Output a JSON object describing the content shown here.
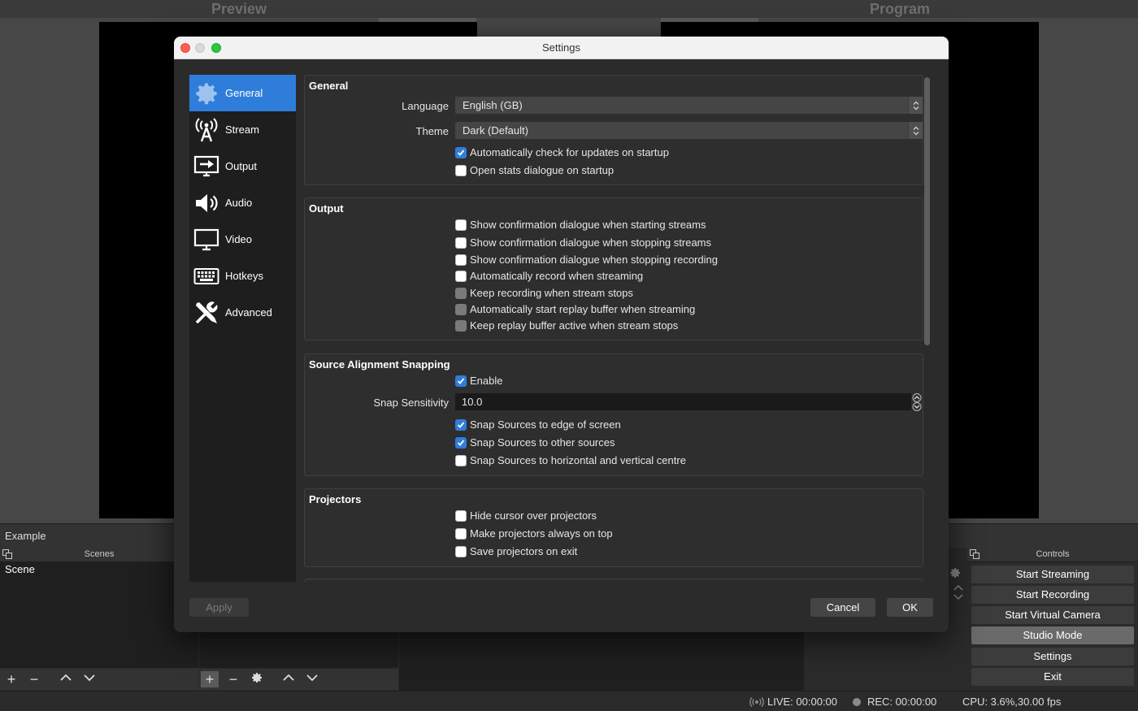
{
  "background": {
    "preview_label": "Preview",
    "program_label": "Program",
    "scene_collection": "Example",
    "scenes_dock_title": "Scenes",
    "scene_items": [
      "Scene"
    ],
    "controls_dock_title": "Controls",
    "controls": [
      "Start Streaming",
      "Start Recording",
      "Start Virtual Camera",
      "Studio Mode",
      "Settings",
      "Exit"
    ],
    "status": {
      "live": "LIVE: 00:00:00",
      "rec": "REC: 00:00:00",
      "cpu": "CPU: 3.6%,30.00 fps"
    }
  },
  "dialog": {
    "title": "Settings",
    "sidebar": [
      {
        "label": "General",
        "icon": "gear-icon",
        "selected": true
      },
      {
        "label": "Stream",
        "icon": "antenna-icon"
      },
      {
        "label": "Output",
        "icon": "output-icon"
      },
      {
        "label": "Audio",
        "icon": "speaker-icon"
      },
      {
        "label": "Video",
        "icon": "monitor-icon"
      },
      {
        "label": "Hotkeys",
        "icon": "keyboard-icon"
      },
      {
        "label": "Advanced",
        "icon": "tools-icon"
      }
    ],
    "general": {
      "title": "General",
      "language_label": "Language",
      "language_value": "English (GB)",
      "theme_label": "Theme",
      "theme_value": "Dark (Default)",
      "checkboxes": [
        {
          "label": "Automatically check for updates on startup",
          "checked": true
        },
        {
          "label": "Open stats dialogue on startup",
          "checked": false
        }
      ]
    },
    "output": {
      "title": "Output",
      "checkboxes": [
        {
          "label": "Show confirmation dialogue when starting streams",
          "checked": false
        },
        {
          "label": "Show confirmation dialogue when stopping streams",
          "checked": false
        },
        {
          "label": "Show confirmation dialogue when stopping recording",
          "checked": false
        },
        {
          "label": "Automatically record when streaming",
          "checked": false
        },
        {
          "label": "Keep recording when stream stops",
          "checked": false,
          "disabled": true
        },
        {
          "label": "Automatically start replay buffer when streaming",
          "checked": false,
          "disabled": true
        },
        {
          "label": "Keep replay buffer active when stream stops",
          "checked": false,
          "disabled": true
        }
      ]
    },
    "snapping": {
      "title": "Source Alignment Snapping",
      "enable_label": "Enable",
      "enable_checked": true,
      "sensitivity_label": "Snap Sensitivity",
      "sensitivity_value": "10.0",
      "checkboxes": [
        {
          "label": "Snap Sources to edge of screen",
          "checked": true
        },
        {
          "label": "Snap Sources to other sources",
          "checked": true
        },
        {
          "label": "Snap Sources to horizontal and vertical centre",
          "checked": false
        }
      ]
    },
    "projectors": {
      "title": "Projectors",
      "checkboxes": [
        {
          "label": "Hide cursor over projectors",
          "checked": false
        },
        {
          "label": "Make projectors always on top",
          "checked": false
        },
        {
          "label": "Save projectors on exit",
          "checked": false
        }
      ]
    },
    "buttons": {
      "apply": "Apply",
      "cancel": "Cancel",
      "ok": "OK"
    },
    "colors": {
      "accent": "#2f7ddb"
    }
  }
}
